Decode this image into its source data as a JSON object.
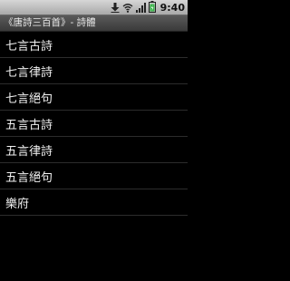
{
  "status_bar": {
    "time": "9:40",
    "icons": [
      "download-icon",
      "wifi-icon",
      "signal-icon",
      "battery-icon"
    ],
    "battery_color": "#3ab54a"
  },
  "app": {
    "title": "《唐詩三百首》- 詩體"
  },
  "list": {
    "items": [
      {
        "label": "七言古詩"
      },
      {
        "label": "七言律詩"
      },
      {
        "label": "七言絕句"
      },
      {
        "label": "五言古詩"
      },
      {
        "label": "五言律詩"
      },
      {
        "label": "五言絕句"
      },
      {
        "label": "樂府"
      }
    ]
  }
}
